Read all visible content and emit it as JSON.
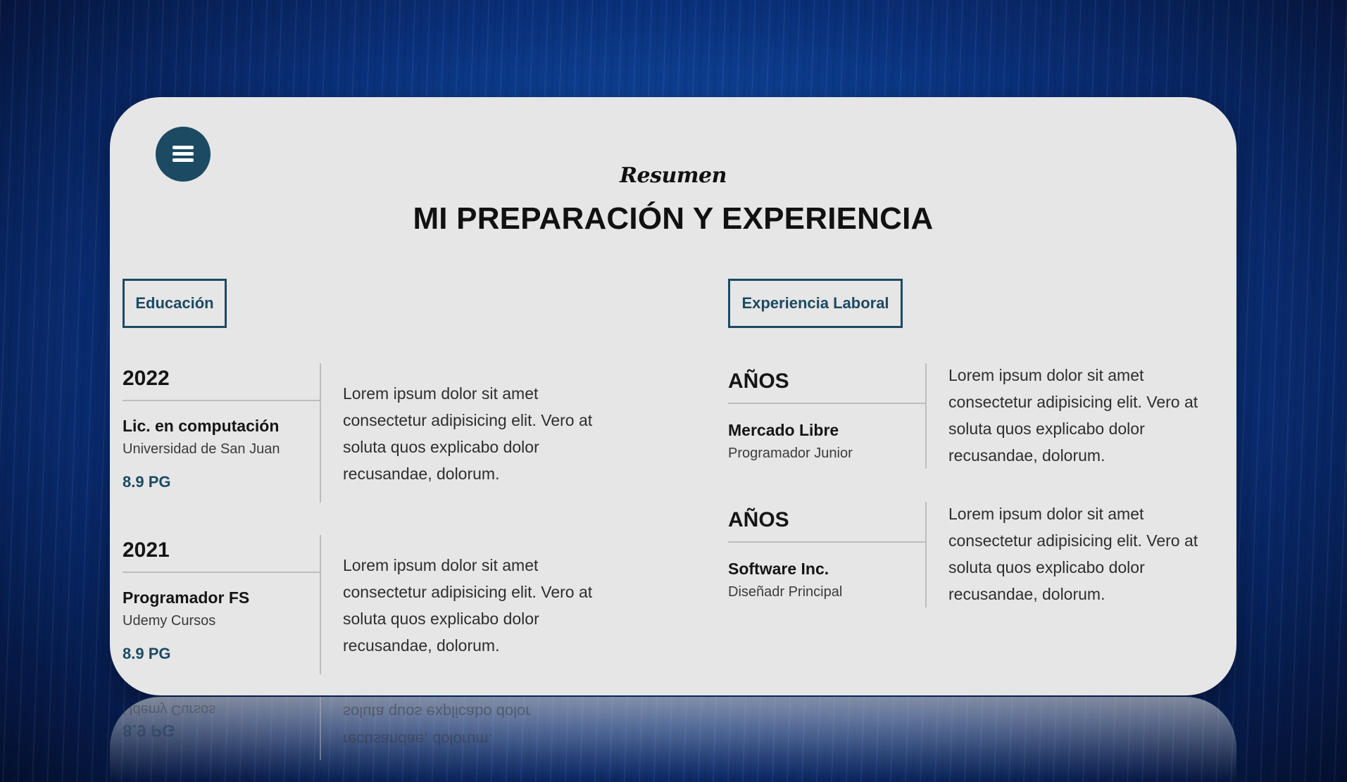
{
  "header": {
    "kicker": "Resumen",
    "title": "MI PREPARACIÓN Y EXPERIENCIA",
    "menu_icon": "hamburger-menu-icon"
  },
  "sections": {
    "education_label": "Educación",
    "experience_label": "Experiencia Laboral"
  },
  "education": [
    {
      "year": "2022",
      "degree": "Lic. en computación",
      "school": "Universidad de San Juan",
      "grade": "8.9 PG",
      "description": "Lorem ipsum dolor sit amet consectetur adipisicing elit. Vero at soluta quos explicabo dolor recusandae, dolorum."
    },
    {
      "year": "2021",
      "degree": "Programador FS",
      "school": "Udemy Cursos",
      "grade": "8.9 PG",
      "description": "Lorem ipsum dolor sit amet consectetur adipisicing elit. Vero at soluta quos explicabo dolor recusandae, dolorum."
    }
  ],
  "experience": [
    {
      "years": "AÑOS",
      "company": "Mercado Libre",
      "role": "Programador Junior",
      "description": "Lorem ipsum dolor sit amet consectetur adipisicing elit. Vero at soluta quos explicabo dolor recusandae, dolorum."
    },
    {
      "years": "AÑOS",
      "company": "Software Inc.",
      "role": "Diseñadr Principal",
      "description": "Lorem ipsum dolor sit amet consectetur adipisicing elit. Vero at soluta quos explicabo dolor recusandae, dolorum."
    }
  ],
  "reflection": {
    "grade": "8.9 PG",
    "school": "Udemy Cursos",
    "line1": "soluta quos explicabo dolor",
    "line2": "recusandae, dolorum."
  },
  "colors": {
    "accent": "#1c4a63",
    "card_bg": "#e6e6e6",
    "background": "#0a2f78"
  }
}
